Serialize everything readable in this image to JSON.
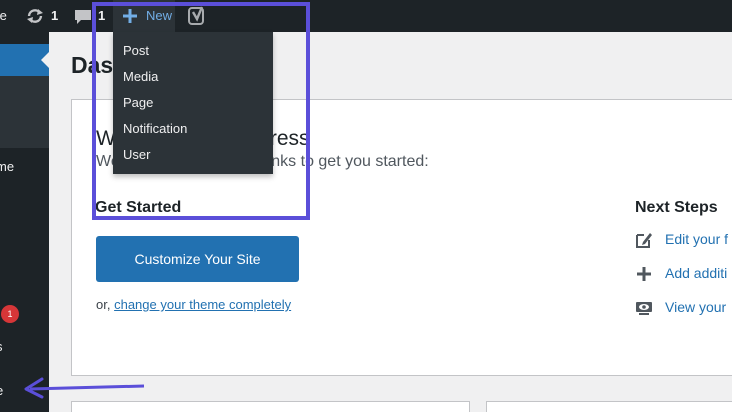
{
  "admin_bar": {
    "site_name_fragment": "fe",
    "updates_count": "1",
    "comments_count": "1",
    "new_label": "New",
    "new_menu": [
      "Post",
      "Media",
      "Page",
      "Notification",
      "User"
    ]
  },
  "sidebar": {
    "labels": [
      "me",
      "s",
      "e"
    ],
    "badge": "1"
  },
  "main": {
    "page_title": "Dash",
    "welcome_heading": "W",
    "welcome_heading_tail": "ress",
    "welcome_sub_a": "We",
    "welcome_sub_b": "inks to get you started:",
    "get_started": "Get Started",
    "customize_button": "Customize Your Site",
    "or_text": "or,",
    "change_theme_link": "change your theme completely",
    "next_steps": "Next Steps",
    "next_steps_items": [
      {
        "icon": "edit-icon",
        "label": "Edit your f"
      },
      {
        "icon": "plus-icon",
        "label": "Add additi"
      },
      {
        "icon": "view-icon",
        "label": "View your"
      }
    ]
  },
  "colors": {
    "admin_bar": "#1d2327",
    "wp_blue": "#2271b1",
    "annotation": "#5b4fd9",
    "badge_red": "#d63638"
  }
}
